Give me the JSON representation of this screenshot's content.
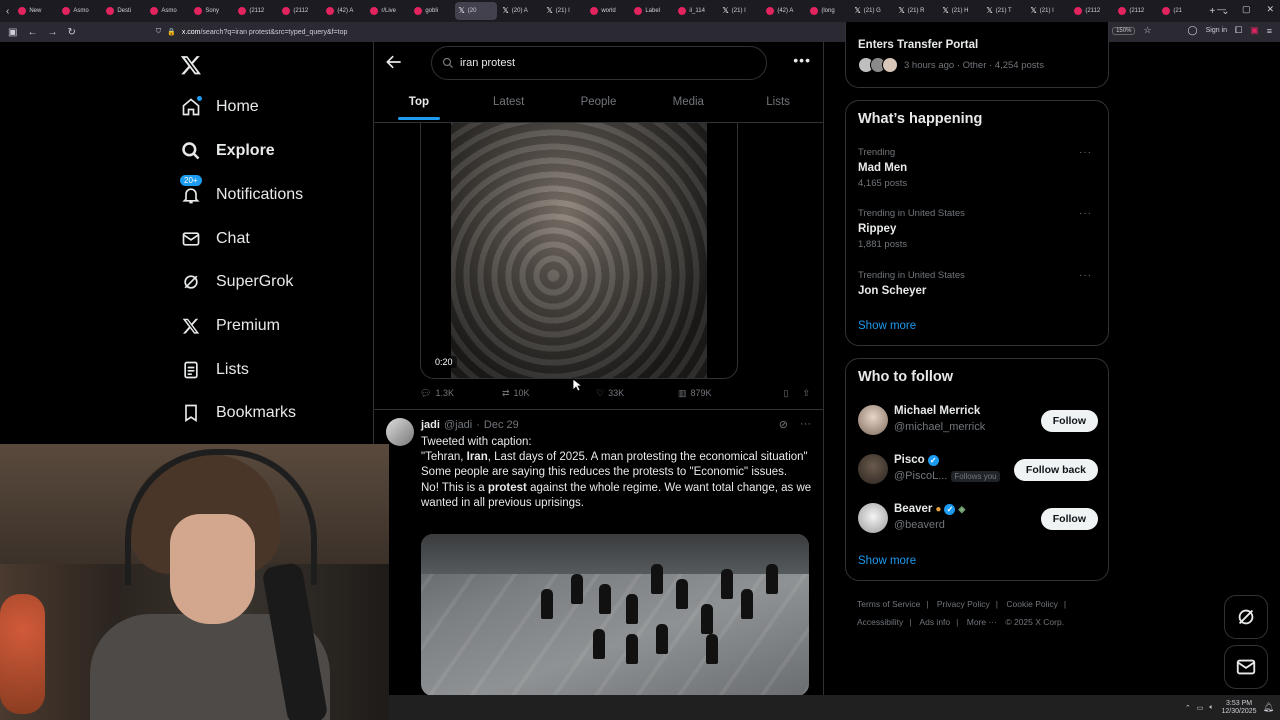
{
  "browser": {
    "tabs": [
      {
        "label": "New",
        "icon": "circle"
      },
      {
        "label": "Asmo",
        "icon": "circle"
      },
      {
        "label": "Desti",
        "icon": "circle"
      },
      {
        "label": "Asmo",
        "icon": "circle"
      },
      {
        "label": "Sony",
        "icon": "circle"
      },
      {
        "label": "(2112",
        "icon": "circle"
      },
      {
        "label": "(2112",
        "icon": "circle"
      },
      {
        "label": "(42) A",
        "icon": "circle"
      },
      {
        "label": "r/Live",
        "icon": "circle"
      },
      {
        "label": "gobli",
        "icon": "circle"
      },
      {
        "label": "(20",
        "icon": "x",
        "active": true
      },
      {
        "label": "(20) A",
        "icon": "x"
      },
      {
        "label": "(21) I",
        "icon": "x"
      },
      {
        "label": "world",
        "icon": "circle"
      },
      {
        "label": "Label",
        "icon": "circle"
      },
      {
        "label": "il_114",
        "icon": "circle"
      },
      {
        "label": "(21) I",
        "icon": "x"
      },
      {
        "label": "(42) A",
        "icon": "circle"
      },
      {
        "label": "(long",
        "icon": "circle"
      },
      {
        "label": "(21) G",
        "icon": "x"
      },
      {
        "label": "(21) R",
        "icon": "x"
      },
      {
        "label": "(21) H",
        "icon": "x"
      },
      {
        "label": "(21) T",
        "icon": "x"
      },
      {
        "label": "(21) I",
        "icon": "x"
      },
      {
        "label": "(2112",
        "icon": "circle"
      },
      {
        "label": "(2112",
        "icon": "circle"
      },
      {
        "label": "(21",
        "icon": "circle"
      }
    ],
    "url_host": "x.com",
    "url_path": "/search?q=iran protest&src=typed_query&f=top",
    "zoom": "150%",
    "signin": "Sign in"
  },
  "leftnav": {
    "items": [
      {
        "label": "Home",
        "icon": "home-icon"
      },
      {
        "label": "Explore",
        "icon": "search-icon"
      },
      {
        "label": "Notifications",
        "icon": "bell-icon",
        "badge": "20+"
      },
      {
        "label": "Chat",
        "icon": "mail-icon"
      },
      {
        "label": "SuperGrok",
        "icon": "grok-icon"
      },
      {
        "label": "Premium",
        "icon": "x-icon"
      },
      {
        "label": "Lists",
        "icon": "list-icon"
      },
      {
        "label": "Bookmarks",
        "icon": "bookmark-icon"
      }
    ]
  },
  "search": {
    "query": "iran protest",
    "tabs": [
      "Top",
      "Latest",
      "People",
      "Media",
      "Lists"
    ]
  },
  "tweet1": {
    "duration": "0:20",
    "replies": "1.3K",
    "reposts": "10K",
    "likes": "33K",
    "views": "879K"
  },
  "tweet2": {
    "name": "jadi",
    "handle": "@jadi",
    "date": "Dec 29",
    "line1": "Tweeted with caption:",
    "line2a": "\"Tehran, ",
    "line2b": "Iran",
    "line2c": ", Last days of 2025. A man protesting the economical situation\"",
    "line3": "Some people are saying this reduces the protests to \"Economic\" issues.",
    "line4a": "No! This is a ",
    "line4b": "protest",
    "line4c": " against the whole regime. We want total change, as we wanted in all previous uprisings."
  },
  "right": {
    "top_card": {
      "title": "Enters Transfer Portal",
      "meta": "3 hours ago · Other · 4,254 posts"
    },
    "happening": {
      "title": "What’s happening",
      "trends": [
        {
          "context": "Trending",
          "name": "Mad Men",
          "count": "4,165 posts"
        },
        {
          "context": "Trending in United States",
          "name": "Rippey",
          "count": "1,881 posts"
        },
        {
          "context": "Trending in United States",
          "name": "Jon Scheyer",
          "count": ""
        }
      ],
      "show_more": "Show more"
    },
    "who_to_follow": {
      "title": "Who to follow",
      "users": [
        {
          "name": "Michael Merrick",
          "handle": "@michael_merrick",
          "button": "Follow",
          "follows_you": ""
        },
        {
          "name": "Pisco",
          "handle": "@PiscoL...",
          "button": "Follow back",
          "follows_you": "Follows you"
        },
        {
          "name": "Beaver",
          "handle": "@beaverd",
          "button": "Follow",
          "follows_you": ""
        }
      ],
      "show_more": "Show more"
    },
    "footer": {
      "links": [
        "Terms of Service",
        "Privacy Policy",
        "Cookie Policy",
        "Accessibility",
        "Ads info",
        "More ···",
        "© 2025 X Corp."
      ]
    }
  },
  "taskbar": {
    "time": "3:53 PM",
    "date": "12/30/2025"
  },
  "colors": {
    "accent": "#1d9bf0",
    "background": "#000000",
    "border": "#2f3336",
    "muted_text": "#71767b"
  }
}
